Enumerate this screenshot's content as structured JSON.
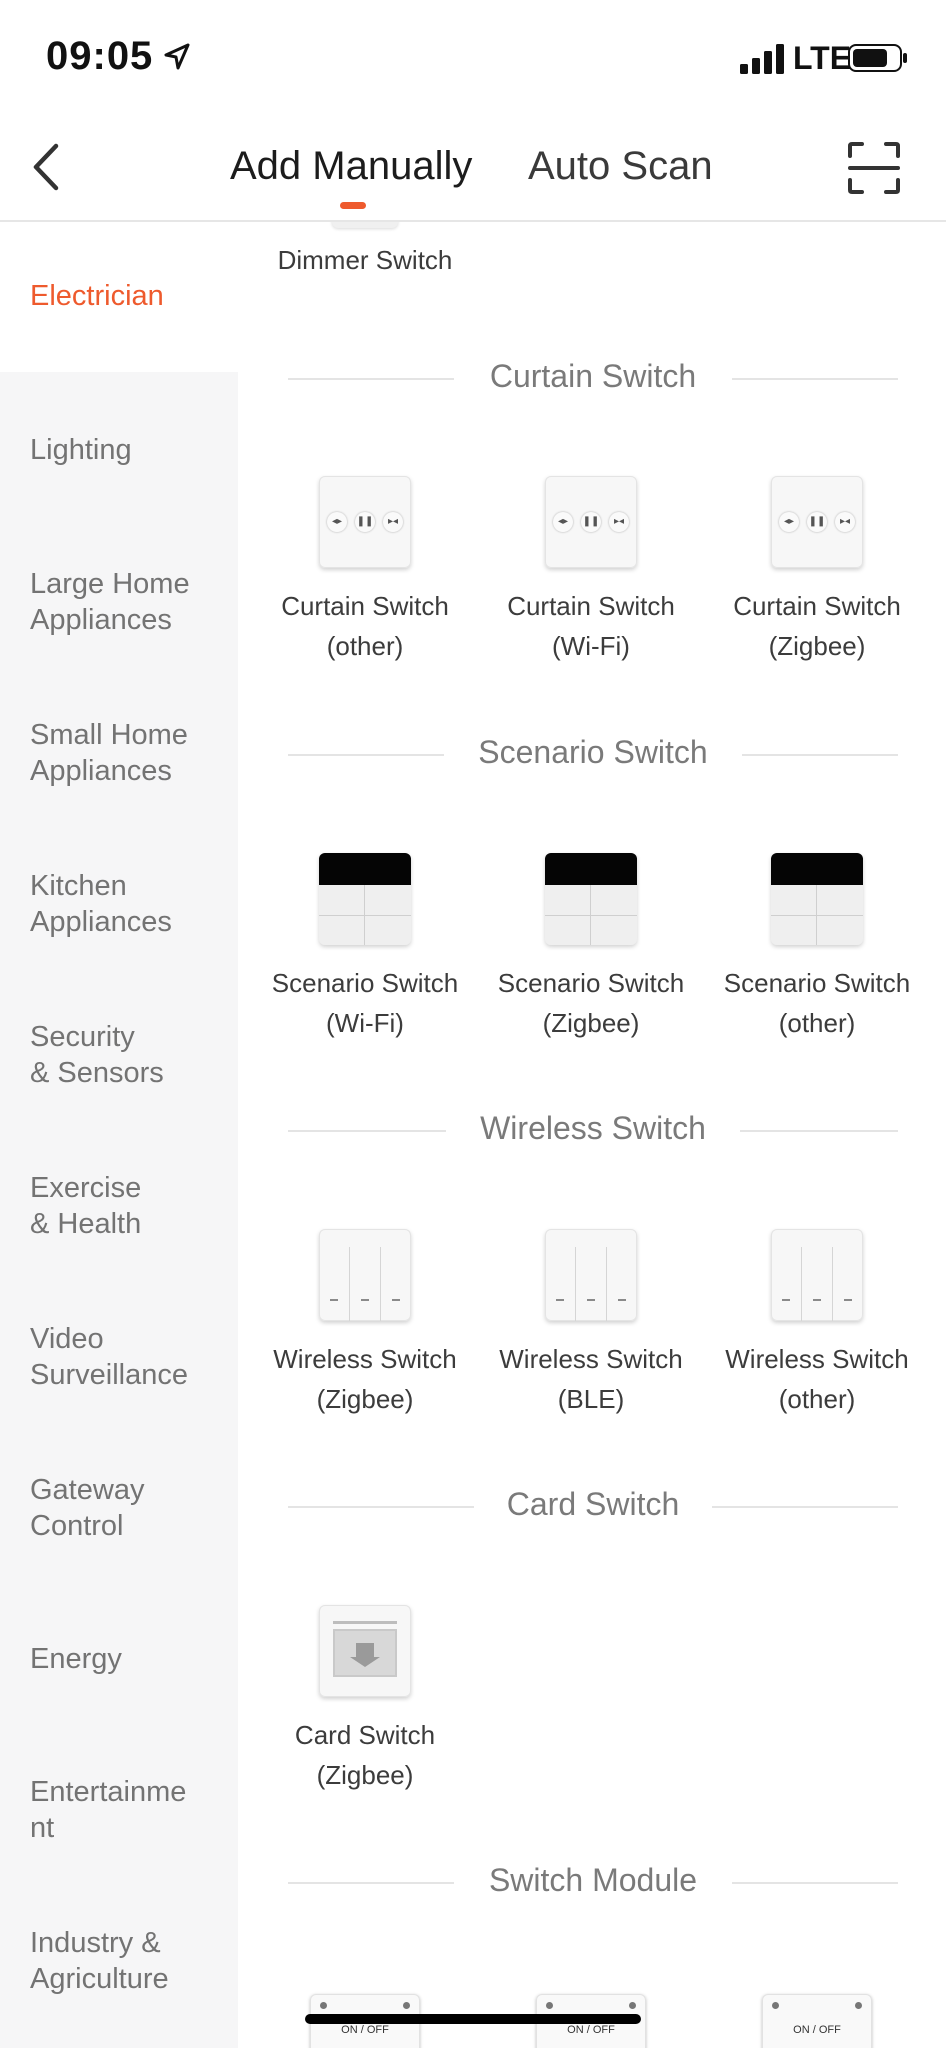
{
  "status_bar": {
    "time": "09:05",
    "network": "LTE"
  },
  "header": {
    "tabs": [
      {
        "label": "Add Manually",
        "active": true
      },
      {
        "label": "Auto Scan",
        "active": false
      }
    ],
    "accent_color": "#ee5a2d"
  },
  "sidebar": {
    "items": [
      {
        "label": "Electrician",
        "active": true
      },
      {
        "label": "Lighting"
      },
      {
        "label": "Large Home\nAppliances"
      },
      {
        "label": "Small Home\nAppliances"
      },
      {
        "label": "Kitchen\nAppliances"
      },
      {
        "label": "Security\n& Sensors"
      },
      {
        "label": "Exercise\n& Health"
      },
      {
        "label": "Video\nSurveillance"
      },
      {
        "label": "Gateway\nControl"
      },
      {
        "label": "Energy"
      },
      {
        "label": "Entertainme\nnt"
      },
      {
        "label": "Industry &\nAgriculture"
      }
    ]
  },
  "main": {
    "top_device": {
      "label": "Dimmer Switch"
    },
    "sections": [
      {
        "title": "Curtain Switch",
        "devices": [
          {
            "label": "Curtain Switch\n(other)",
            "icon": "curtain-switch-icon"
          },
          {
            "label": "Curtain Switch\n(Wi-Fi)",
            "icon": "curtain-switch-icon"
          },
          {
            "label": "Curtain Switch\n(Zigbee)",
            "icon": "curtain-switch-icon"
          }
        ]
      },
      {
        "title": "Scenario Switch",
        "devices": [
          {
            "label": "Scenario Switch\n(Wi-Fi)",
            "icon": "scenario-switch-icon"
          },
          {
            "label": "Scenario Switch\n(Zigbee)",
            "icon": "scenario-switch-icon"
          },
          {
            "label": "Scenario Switch\n(other)",
            "icon": "scenario-switch-icon"
          }
        ]
      },
      {
        "title": "Wireless Switch",
        "devices": [
          {
            "label": "Wireless Switch\n(Zigbee)",
            "icon": "wireless-switch-icon"
          },
          {
            "label": "Wireless Switch\n(BLE)",
            "icon": "wireless-switch-icon"
          },
          {
            "label": "Wireless Switch\n(other)",
            "icon": "wireless-switch-icon"
          }
        ]
      },
      {
        "title": "Card Switch",
        "devices": [
          {
            "label": "Card Switch\n(Zigbee)",
            "icon": "card-switch-icon"
          }
        ]
      },
      {
        "title": "Switch Module",
        "devices": [
          {
            "label": "ON / OFF",
            "icon": "switch-module-icon"
          },
          {
            "label": "ON / OFF",
            "icon": "switch-module-icon"
          },
          {
            "label": "ON / OFF",
            "icon": "switch-module-icon"
          }
        ]
      }
    ]
  }
}
